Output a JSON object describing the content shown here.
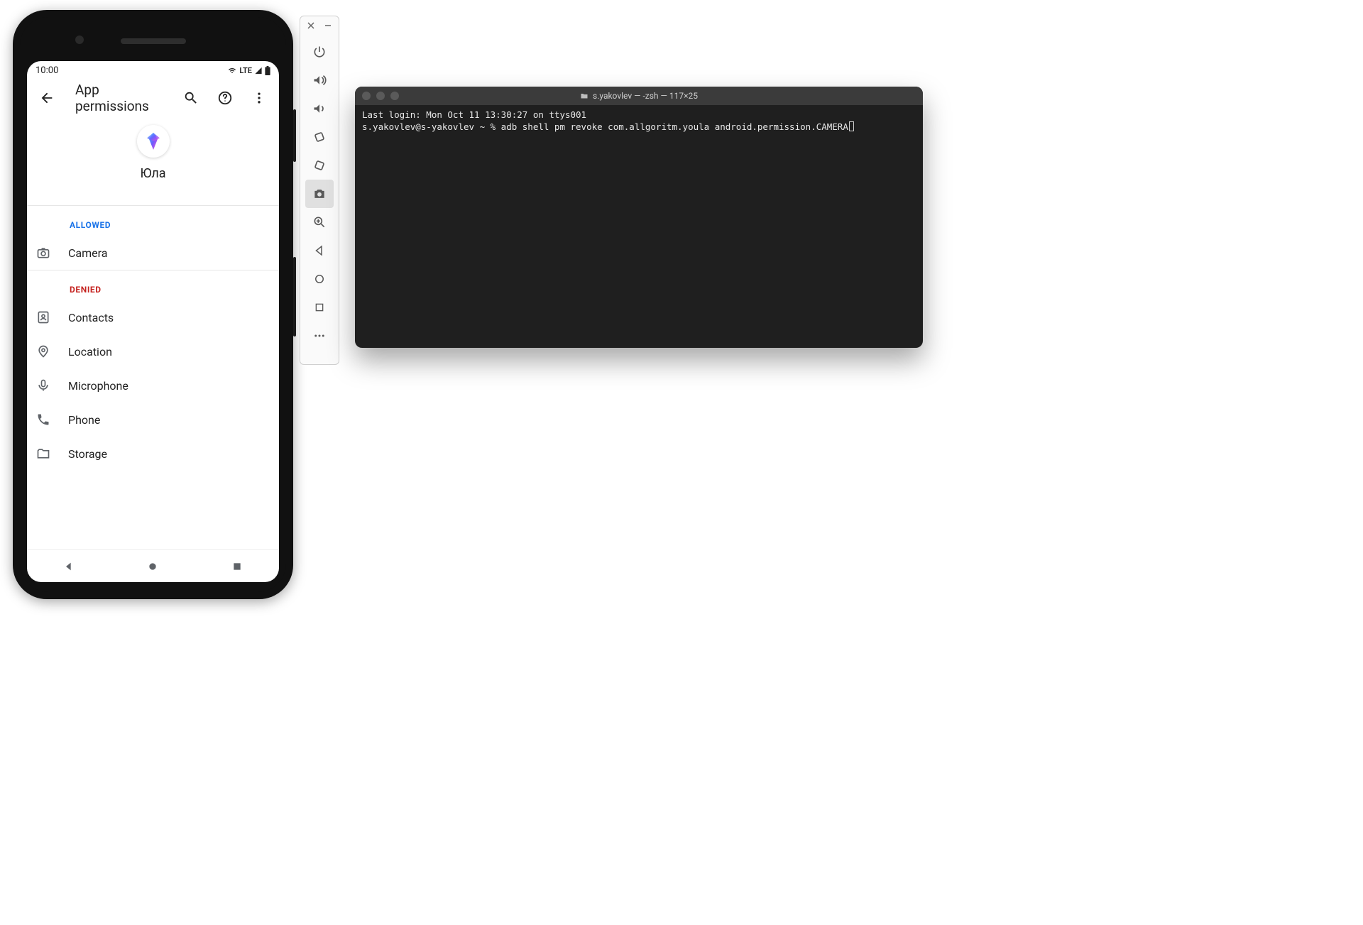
{
  "phone": {
    "status": {
      "time": "10:00",
      "network_label": "LTE"
    },
    "toolbar": {
      "title": "App permissions"
    },
    "app": {
      "name": "Юла"
    },
    "sections": {
      "allowed_label": "ALLOWED",
      "denied_label": "DENIED"
    },
    "allowed": [
      {
        "label": "Camera",
        "icon": "camera-icon"
      }
    ],
    "denied": [
      {
        "label": "Contacts",
        "icon": "contacts-icon"
      },
      {
        "label": "Location",
        "icon": "location-icon"
      },
      {
        "label": "Microphone",
        "icon": "microphone-icon"
      },
      {
        "label": "Phone",
        "icon": "phone-icon"
      },
      {
        "label": "Storage",
        "icon": "storage-icon"
      }
    ]
  },
  "emulator_toolbar": {
    "buttons": [
      "power-icon",
      "volume-up-icon",
      "volume-down-icon",
      "rotate-left-icon",
      "rotate-right-icon",
      "camera-icon",
      "zoom-icon",
      "back-icon",
      "home-icon",
      "overview-icon",
      "more-icon"
    ],
    "active": "camera-icon"
  },
  "terminal": {
    "title": "s.yakovlev — -zsh — 117×25",
    "lines": {
      "line1": "Last login: Mon Oct 11 13:30:27 on ttys001",
      "prompt": "s.yakovlev@s-yakovlev ~ % ",
      "command": "adb shell pm revoke com.allgoritm.youla android.permission.CAMERA"
    }
  }
}
